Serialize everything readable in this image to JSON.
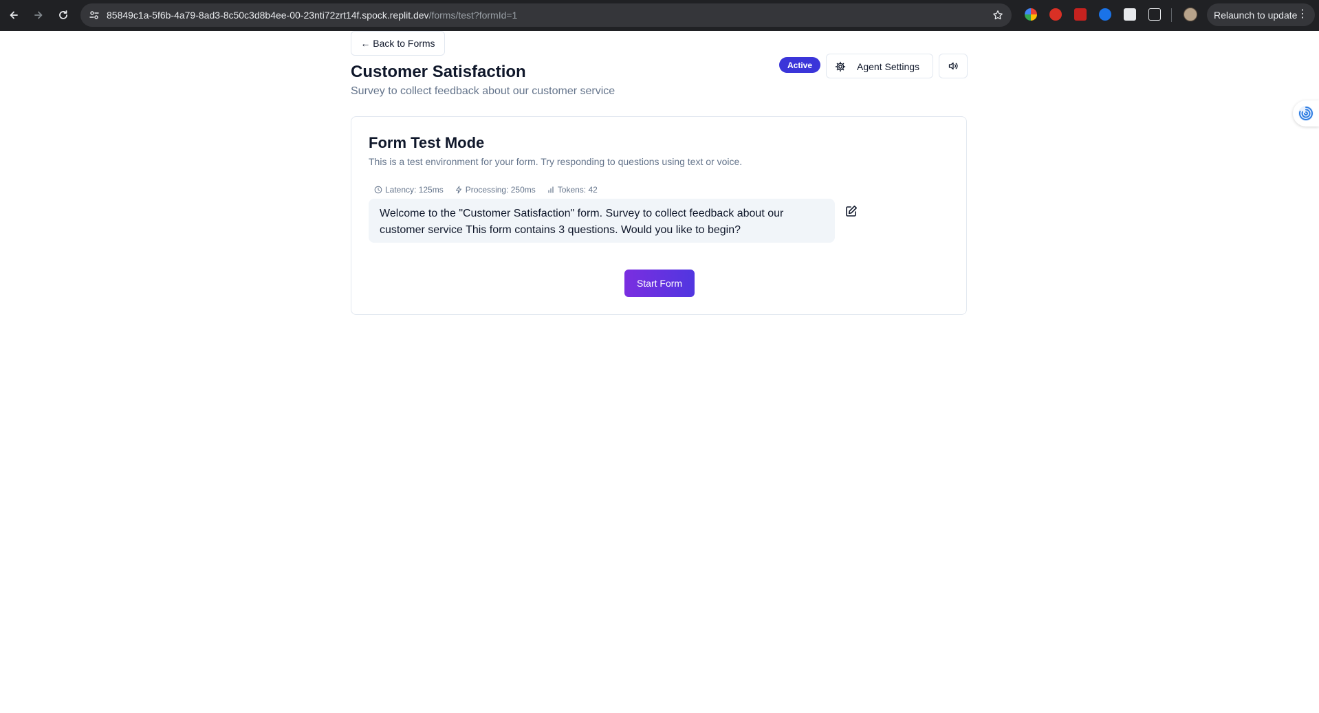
{
  "browser": {
    "url_host": "85849c1a-5f6b-4a79-8ad3-8c50c3d8b4ee-00-23nti72zrt14f.spock.replit.dev",
    "url_path": "/forms/test?formId=1",
    "relaunch_label": "Relaunch to update"
  },
  "header": {
    "back_label": "← Back to Forms",
    "title": "Customer Satisfaction",
    "subtitle": "Survey to collect feedback about our customer service",
    "status_badge": "Active",
    "agent_settings_label": "Agent Settings"
  },
  "card": {
    "title": "Form Test Mode",
    "description": "This is a test environment for your form. Try responding to questions using text or voice.",
    "metrics": {
      "latency": "Latency: 125ms",
      "processing": "Processing: 250ms",
      "tokens": "Tokens: 42"
    },
    "message": "Welcome to the \"Customer Satisfaction\" form. Survey to collect feedback about our customer service This form contains 3 questions. Would you like to begin?",
    "start_label": "Start Form"
  },
  "colors": {
    "badge": "#3b35d9",
    "start_gradient_from": "#7a2ee0",
    "start_gradient_to": "#5136e0",
    "chrome_bg": "#202124"
  }
}
